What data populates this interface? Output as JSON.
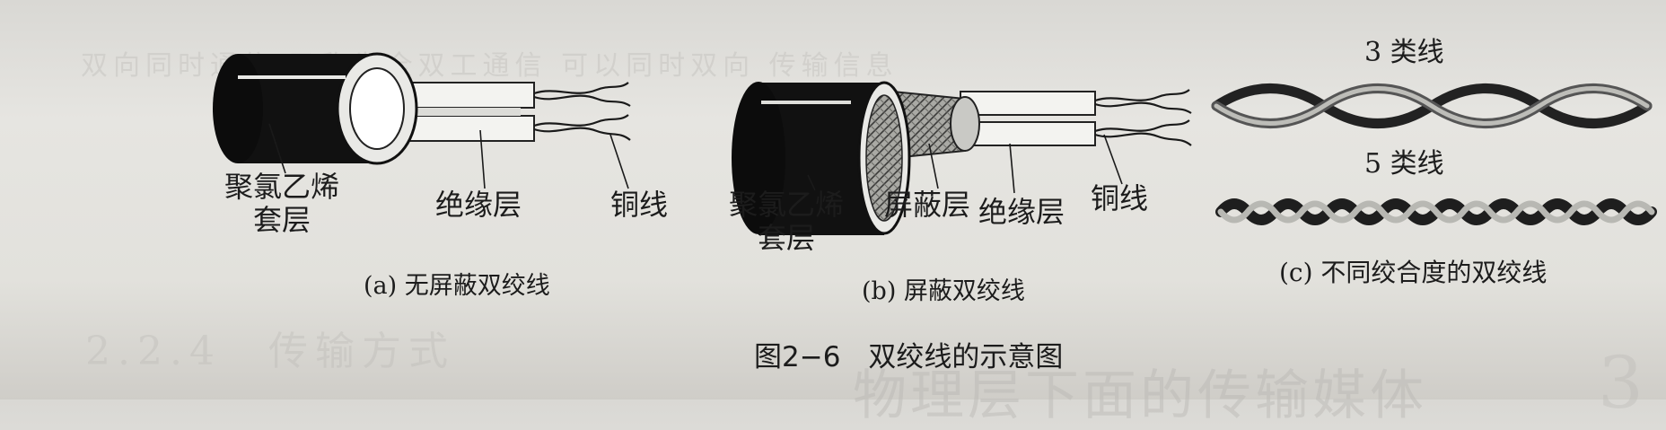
{
  "figure": {
    "caption": "图2−6　双绞线的示意图",
    "panel_a": {
      "jacket_label": "聚氯乙烯\n套层",
      "insulation_label": "绝缘层",
      "copper_label": "铜线",
      "caption": "(a) 无屏蔽双绞线"
    },
    "panel_b": {
      "jacket_label": "聚氯乙烯\n套层",
      "shield_label": "屏蔽层",
      "insulation_label": "绝缘层",
      "copper_label": "铜线",
      "caption": "(b) 屏蔽双绞线"
    },
    "panel_c": {
      "cat3_label": "3 类线",
      "cat5_label": "5 类线",
      "caption": "(c) 不同绞合度的双绞线"
    }
  },
  "background_bleed": {
    "top_line": "双向同时通信  又称为全双工通信  可以同时双向  传输信息",
    "section_heading": "2.2.4　传输方式",
    "chapter_heading": "物理层下面的传输媒体",
    "chapter_number": "3"
  },
  "colors": {
    "jacket": "#111111",
    "paper": "#e4e3df",
    "ink": "#1c1c1c"
  }
}
